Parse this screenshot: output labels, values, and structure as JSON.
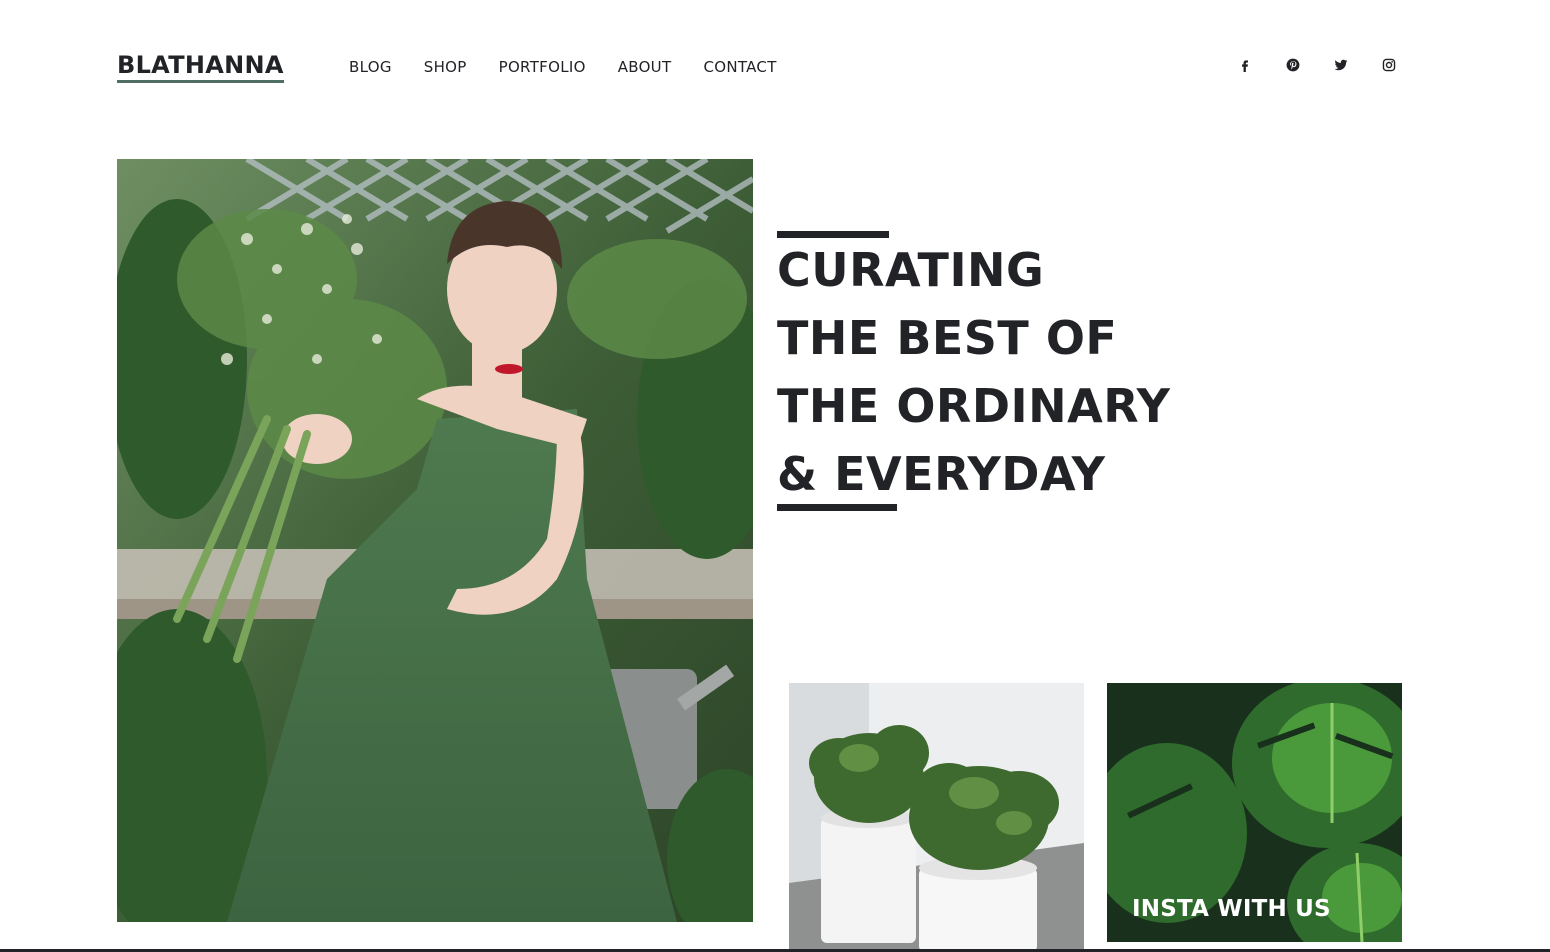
{
  "brand": {
    "name": "BLATHANNA",
    "underline_color": "#4f6f63"
  },
  "nav": {
    "items": [
      {
        "label": "BLOG"
      },
      {
        "label": "SHOP"
      },
      {
        "label": "PORTFOLIO"
      },
      {
        "label": "ABOUT"
      },
      {
        "label": "CONTACT"
      }
    ]
  },
  "social": [
    {
      "icon": "facebook-icon"
    },
    {
      "icon": "pinterest-icon"
    },
    {
      "icon": "twitter-icon"
    },
    {
      "icon": "instagram-icon"
    }
  ],
  "hero": {
    "headline_lines": [
      "CURATING",
      "THE BEST OF",
      "THE ORDINARY",
      "& EVERYDAY"
    ],
    "image": "woman-green-dress-holding-flowers"
  },
  "gallery": {
    "plant_image": "white-pots-with-succulents",
    "insta": {
      "label": "INSTA WITH US",
      "image": "monstera-leaves"
    }
  },
  "colors": {
    "text": "#222327",
    "background": "#ffffff",
    "accent": "#4f6f63"
  }
}
